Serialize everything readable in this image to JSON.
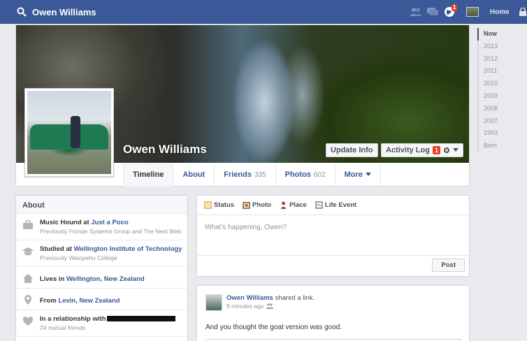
{
  "topbar": {
    "name": "Owen Williams",
    "notification_count": "1",
    "home_label": "Home"
  },
  "cover": {
    "name": "Owen Williams",
    "update_info_label": "Update Info",
    "activity_log_label": "Activity Log",
    "activity_log_count": "1"
  },
  "tabs": [
    {
      "label": "Timeline",
      "count": ""
    },
    {
      "label": "About",
      "count": ""
    },
    {
      "label": "Friends",
      "count": "335"
    },
    {
      "label": "Photos",
      "count": "602"
    },
    {
      "label": "More",
      "count": ""
    }
  ],
  "years": [
    "Now",
    "2013",
    "2012",
    "2011",
    "2010",
    "2009",
    "2008",
    "2007",
    "1993",
    "Born"
  ],
  "about": {
    "title": "About",
    "work": {
      "prefix": "Music Hound at ",
      "link": "Just a Poco",
      "sub": "Previously Fronde Systems Group and The Next Web"
    },
    "education": {
      "prefix": "Studied at ",
      "link": "Wellington Institute of Technology",
      "sub": "Previously Waiopehu College"
    },
    "lives": {
      "prefix": "Lives in ",
      "link": "Wellington, New Zealand"
    },
    "from": {
      "prefix": "From ",
      "link": "Levin, New Zealand"
    },
    "relationship": {
      "prefix": "In a relationship with",
      "sub": "24 mutual friends"
    }
  },
  "composer": {
    "status_label": "Status",
    "photo_label": "Photo",
    "place_label": "Place",
    "life_event_label": "Life Event",
    "placeholder": "What's happening, Owen?",
    "post_label": "Post"
  },
  "story": {
    "author": "Owen Williams",
    "action": "shared a link.",
    "time": "9 minutes ago",
    "text": "And you thought the goat version was good."
  },
  "colors": {
    "brand_blue": "#3b5998",
    "page_bg": "#e9eaed",
    "badge_red": "#f03d25"
  }
}
